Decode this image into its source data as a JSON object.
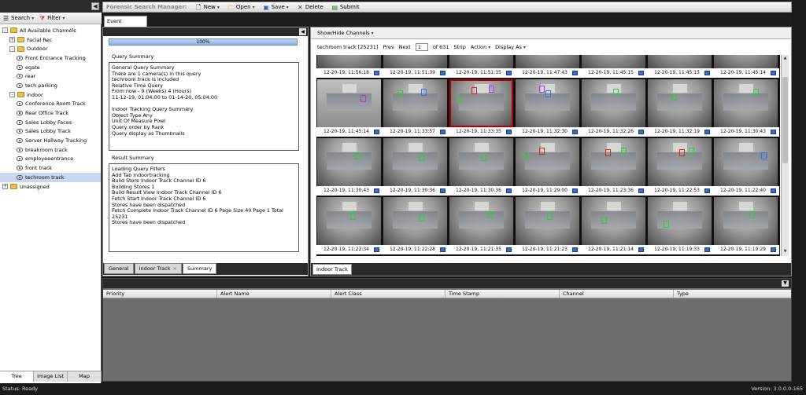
{
  "left_panel": {
    "toolbar": {
      "search": "Search",
      "filter": "Filter"
    },
    "tree": [
      {
        "label": "All Available Channels",
        "level": 0,
        "type": "folder",
        "exp": "-"
      },
      {
        "label": "Facial Rec",
        "level": 1,
        "type": "folder",
        "exp": "+"
      },
      {
        "label": "Outdoor",
        "level": 1,
        "type": "folder",
        "exp": "-"
      },
      {
        "label": "Front Entrance Tracking",
        "level": 2,
        "type": "track"
      },
      {
        "label": "egate",
        "level": 2,
        "type": "cam"
      },
      {
        "label": "rear",
        "level": 2,
        "type": "cam"
      },
      {
        "label": "tech parking",
        "level": 2,
        "type": "track"
      },
      {
        "label": "indoor",
        "level": 1,
        "type": "folder",
        "exp": "-"
      },
      {
        "label": "Conference Room Track",
        "level": 2,
        "type": "cam"
      },
      {
        "label": "Rear Office Track",
        "level": 2,
        "type": "cam"
      },
      {
        "label": "Sales Lobby Faces",
        "level": 2,
        "type": "cam"
      },
      {
        "label": "Sales Lobby Track",
        "level": 2,
        "type": "cam"
      },
      {
        "label": "Server Hallway Tracking",
        "level": 2,
        "type": "cam"
      },
      {
        "label": "breakroom track",
        "level": 2,
        "type": "cam"
      },
      {
        "label": "employeeentrance",
        "level": 2,
        "type": "cam"
      },
      {
        "label": "front track",
        "level": 2,
        "type": "cam"
      },
      {
        "label": "techroom track",
        "level": 2,
        "type": "cam",
        "selected": true
      },
      {
        "label": "Unassigned",
        "level": 0,
        "type": "folder",
        "exp": "+"
      }
    ],
    "bottom_tabs": [
      "Tree",
      "Image List",
      "Map"
    ],
    "active_bottom_tab": "Tree"
  },
  "topbar": {
    "title": "Forensic Search Manager:",
    "new": "New",
    "open": "Open",
    "save": "Save",
    "delete": "Delete",
    "submit": "Submit"
  },
  "main_tab": "Event Search",
  "summary": {
    "progress_text": "100%",
    "progress_value": 1.0,
    "query_summary_title": "Query Summary",
    "query_summary_lines": [
      "General Query Summary",
      "There are 1 camera(s) in this query",
      "techroom track is included",
      "Relative Time Query",
      "From now - 9 (Weeks) 4 (Hours)",
      "11-12-19, 01:04:00 to 01-14-20, 05:04:00",
      "",
      "Indoor Tracking Query Summary",
      "Object Type Any",
      "Unit Of Measure Pixel",
      "Query order by Rank",
      "Query display as Thumbnails"
    ],
    "result_summary_title": "Result Summary",
    "result_summary_lines": [
      "Loading Query Filters",
      "Add Tab indoortracking",
      "Build Store Indoor Track Channel ID 6",
      "Building Stores 1",
      "Build Result View Indoor Track Channel ID 6",
      "Fetch Start Indoor Track Channel ID 6",
      "Stores have been dispatched",
      "Fetch Complete Indoor Track Channel ID 6 Page Size 40 Page 1 Total 25231",
      "Stores have been dispatched"
    ],
    "tabs": [
      "General",
      "Indoor Track",
      "Summary"
    ],
    "active_tab": "Summary"
  },
  "thumbs": {
    "show_hide": "Show/Hide Channels",
    "channel": "techroom track [25231]",
    "prev": "Prev",
    "next": "Next",
    "page": "1",
    "of": "of 631",
    "strip": "Strip",
    "action": "Action",
    "display_as": "Display As",
    "rows": [
      [
        "12-20-19, 11:56:18",
        "12-20-19, 11:51:39",
        "12-20-19, 11:51:35",
        "12-20-19, 11:47:43",
        "12-20-19, 11:45:15",
        "12-20-19, 11:45:15",
        "12-20-19, 11:45:14"
      ],
      [
        "12-20-19, 11:45:14",
        "12-20-19, 11:33:57",
        "12-20-19, 11:33:35",
        "12-20-19, 11:32:30",
        "12-20-19, 11:32:26",
        "12-20-19, 11:32:19",
        "12-20-19, 11:30:43"
      ],
      [
        "12-20-19, 11:30:43",
        "12-20-19, 11:30:36",
        "12-20-19, 11:30:36",
        "12-20-19, 11:29:00",
        "12-20-19, 11:23:36",
        "12-20-19, 11:22:53",
        "12-20-19, 11:22:40"
      ],
      [
        "12-20-19, 11:22:34",
        "12-20-19, 11:22:28",
        "12-20-19, 11:21:35",
        "12-20-19, 11:21:23",
        "12-20-19, 11:21:14",
        "12-20-19, 11:19:33",
        "12-20-19, 11:19:29"
      ]
    ],
    "bottom_tab": "Indoor Track"
  },
  "alerts": {
    "columns": [
      "Priority",
      "Alert Name",
      "Alert Class",
      "Time Stamp",
      "Channel",
      "Type"
    ]
  },
  "status": {
    "left": "Status: Ready",
    "right": "Version: 3.0.0.0-165"
  }
}
